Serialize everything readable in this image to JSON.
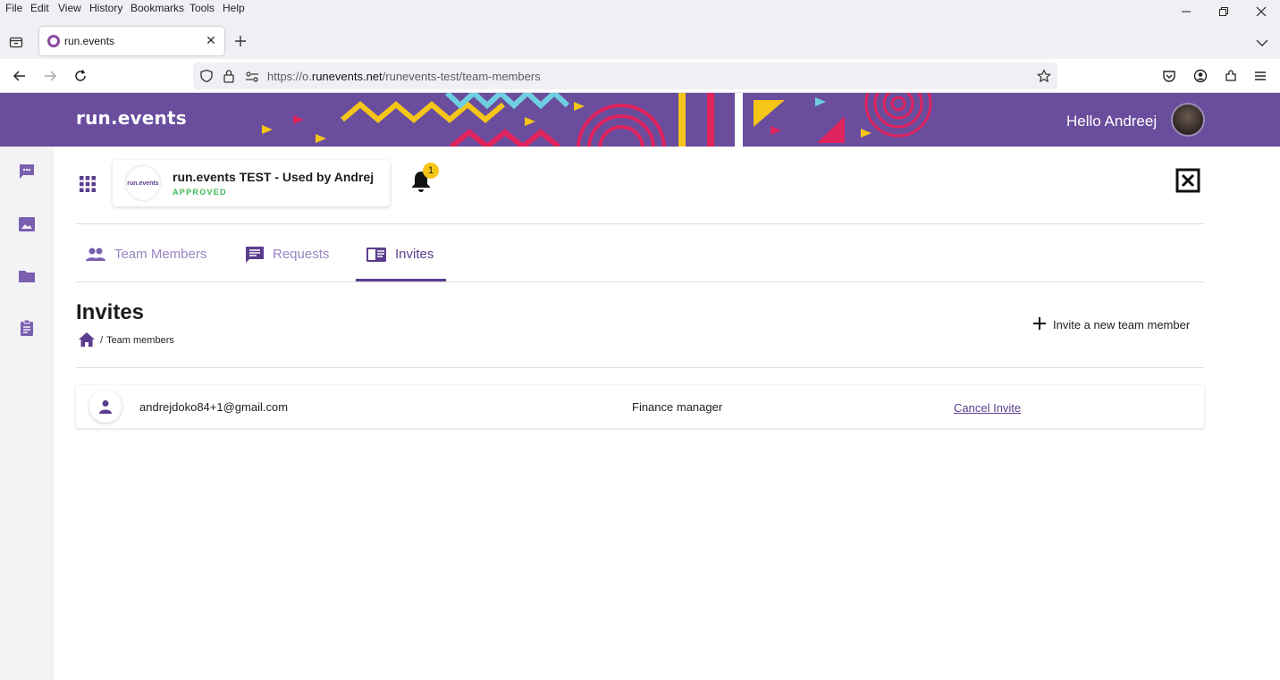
{
  "browser": {
    "menu": [
      "File",
      "Edit",
      "View",
      "History",
      "Bookmarks",
      "Tools",
      "Help"
    ],
    "tab_title": "run.events",
    "new_tab_icon": "plus-icon",
    "url_prefix": "https://o.",
    "url_domain": "runevents.net",
    "url_path": "/runevents-test/team-members"
  },
  "banner": {
    "logo": "run.events",
    "greeting": "Hello Andreej",
    "colors": {
      "purple": "#6a4d9d",
      "yellow": "#f5c518",
      "cyan": "#6fcfe0",
      "pink": "#e0245e"
    }
  },
  "sidebar": {
    "items": [
      {
        "icon": "chat-icon"
      },
      {
        "icon": "image-icon"
      },
      {
        "icon": "folder-icon"
      },
      {
        "icon": "clipboard-icon"
      }
    ]
  },
  "org": {
    "logo_text": "run.events",
    "name": "run.events TEST - Used by Andrej",
    "status": "APPROVED"
  },
  "notifications": {
    "count": "1"
  },
  "tabs": [
    {
      "label": "Team Members",
      "icon": "people-icon",
      "active": false
    },
    {
      "label": "Requests",
      "icon": "comment-icon",
      "active": false
    },
    {
      "label": "Invites",
      "icon": "invite-card-icon",
      "active": true
    }
  ],
  "page": {
    "title": "Invites",
    "breadcrumb_sep": "/",
    "breadcrumb_current": "Team members",
    "invite_button": "Invite a new team member"
  },
  "invites": [
    {
      "email": "andrejdoko84+1@gmail.com",
      "role": "Finance manager",
      "action": "Cancel Invite"
    }
  ],
  "accent_color": "#5b3d8e"
}
